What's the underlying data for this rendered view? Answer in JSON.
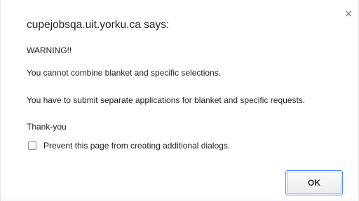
{
  "dialog": {
    "title": "cupejobsqa.uit.yorku.ca says:",
    "close_glyph": "×",
    "close_icon": "close-icon",
    "messages": [
      "WARNING!!",
      "You cannot combine blanket and specific selections.",
      "You have to submit separate applications for blanket and specific requests.",
      "Thank-you"
    ],
    "prevent_label": "Prevent this page from creating additional dialogs.",
    "prevent_checked": false,
    "ok_label": "OK",
    "accent_color": "#4d90fe"
  }
}
